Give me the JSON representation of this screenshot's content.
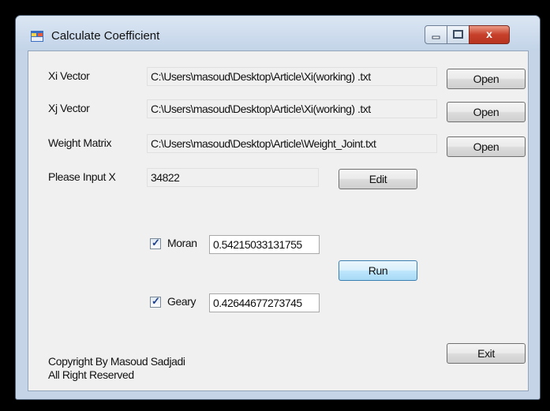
{
  "window": {
    "title": "Calculate Coefficient",
    "controls": {
      "minimize": "minimize",
      "maximize": "maximize",
      "close": "x"
    }
  },
  "rows": [
    {
      "label": "Xi Vector",
      "path": "C:\\Users\\masoud\\Desktop\\Article\\Xi(working) .txt",
      "button": "Open"
    },
    {
      "label": "Xj Vector",
      "path": "C:\\Users\\masoud\\Desktop\\Article\\Xi(working) .txt",
      "button": "Open"
    },
    {
      "label": "Weight Matrix",
      "path": "C:\\Users\\masoud\\Desktop\\Article\\Weight_Joint.txt",
      "button": "Open"
    }
  ],
  "input_x": {
    "label": "Please Input X",
    "value": "34822",
    "button": "Edit"
  },
  "moran": {
    "label": "Moran",
    "checked": true,
    "value": "0.54215033131755"
  },
  "geary": {
    "label": "Geary",
    "checked": true,
    "value": "0.42644677273745"
  },
  "run_button": "Run",
  "exit_button": "Exit",
  "copyright": {
    "line1": "Copyright By Masoud Sadjadi",
    "line2": "All Right Reserved"
  }
}
